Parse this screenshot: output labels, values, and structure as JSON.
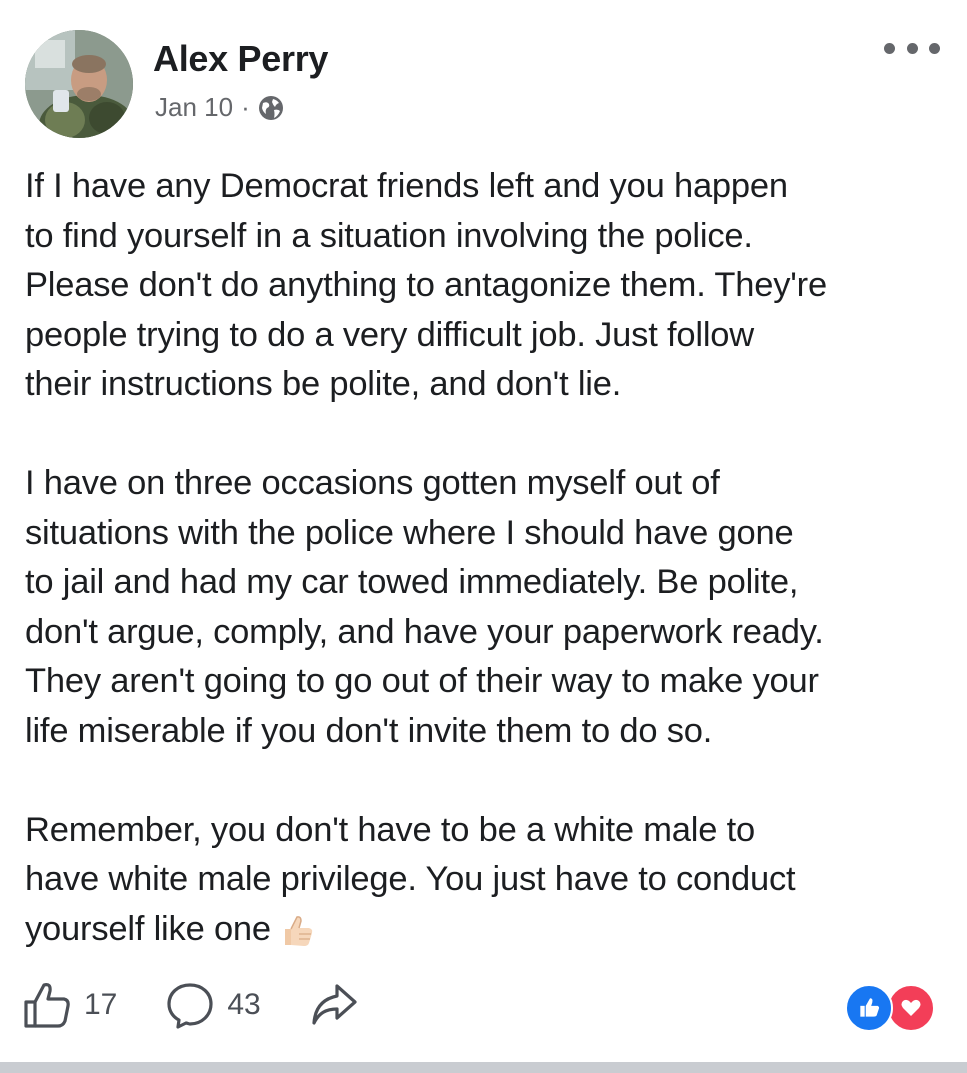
{
  "post": {
    "author": "Alex Perry",
    "date": "Jan 10",
    "separator": "·",
    "privacy_icon": "globe-icon",
    "paragraphs": [
      "If I have any Democrat friends left and you happen\nto find yourself in a situation involving the police.\nPlease don't do anything to antagonize them. They're\npeople trying to do a very difficult job. Just follow\ntheir instructions be polite, and don't lie.",
      "I have on three occasions gotten myself out of\nsituations with the police where I should have gone\nto jail and had my car towed immediately. Be polite,\ndon't argue, comply, and have your paperwork ready.\nThey aren't going to go out of their way to make your\nlife miserable if you don't invite them to do so.",
      "Remember, you don't have to be a white male to\nhave white male privilege. You just have to conduct\nyourself like one"
    ],
    "trailing_emoji": "thumbs-up-emoji"
  },
  "actions": {
    "like_count": "17",
    "comment_count": "43"
  },
  "reactions": [
    "like",
    "love"
  ],
  "colors": {
    "text": "#1c1e21",
    "meta": "#65676b",
    "like": "#1877f2",
    "love": "#f33e58"
  }
}
